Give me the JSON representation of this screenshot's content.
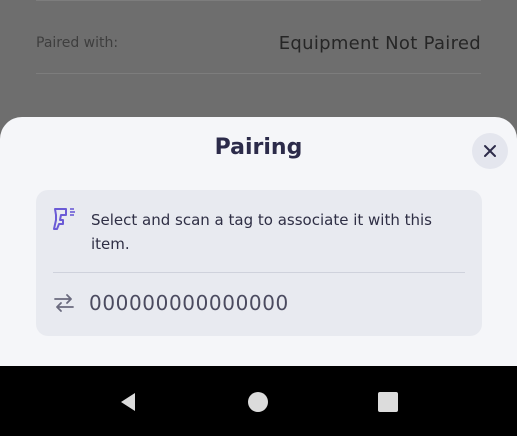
{
  "background": {
    "paired_label": "Paired with:",
    "paired_value": "Equipment Not Paired"
  },
  "dialog": {
    "title": "Pairing",
    "close_icon": "close-icon",
    "message": "Select and scan a tag to associate it with this item.",
    "scan_icon": "scanner-gun-icon",
    "tag_icon": "swap-arrows-icon",
    "tag_value": "000000000000000"
  },
  "colors": {
    "accent": "#6b5bd6",
    "title": "#2c2b4a"
  },
  "navbar": {
    "back_icon": "back-triangle-icon",
    "home_icon": "home-circle-icon",
    "recents_icon": "recents-square-icon"
  }
}
